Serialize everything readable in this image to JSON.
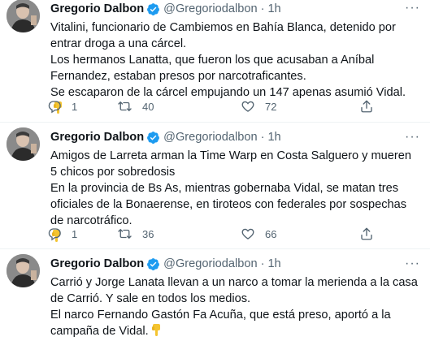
{
  "colors": {
    "verified": "#1d9bf0",
    "muted": "#536471",
    "text": "#0f1419",
    "divider": "#eff3f4",
    "emoji": "#f4c430"
  },
  "tweets": [
    {
      "author": "Gregorio Dalbon",
      "handle": "@Gregoriodalbon",
      "separator": "·",
      "time": "1h",
      "lines": [
        "Vitalini, funcionario de Cambiemos en Bahía Blanca, detenido por entrar droga a una cárcel.",
        "Los hermanos Lanatta, que fueron los que acusaban a Aníbal Fernandez, estaban presos por narcotraficantes.",
        "Se escaparon de la cárcel empujando un 147 apenas asumió Vidal."
      ],
      "emoji": "backhand-index-pointing-down",
      "replies": "1",
      "retweets": "40",
      "likes": "72"
    },
    {
      "author": "Gregorio Dalbon",
      "handle": "@Gregoriodalbon",
      "separator": "·",
      "time": "1h",
      "lines": [
        "Amigos de Larreta arman la Time Warp en Costa Salguero y mueren 5 chicos por sobredosis",
        "En la provincia de Bs As, mientras gobernaba Vidal, se matan tres oficiales de la Bonaerense, en tiroteos con federales por sospechas de narcotráfico."
      ],
      "emoji": "backhand-index-pointing-down",
      "replies": "1",
      "retweets": "36",
      "likes": "66"
    },
    {
      "author": "Gregorio Dalbon",
      "handle": "@Gregoriodalbon",
      "separator": "·",
      "time": "1h",
      "lines": [
        "Carrió y Jorge Lanata llevan a un narco a tomar la merienda a la casa de Carrió. Y sale en todos los medios.",
        "El narco Fernando Gastón Fa Acuña, que está preso, aportó a la campaña de Vidal."
      ],
      "emoji": "backhand-index-pointing-down"
    }
  ]
}
